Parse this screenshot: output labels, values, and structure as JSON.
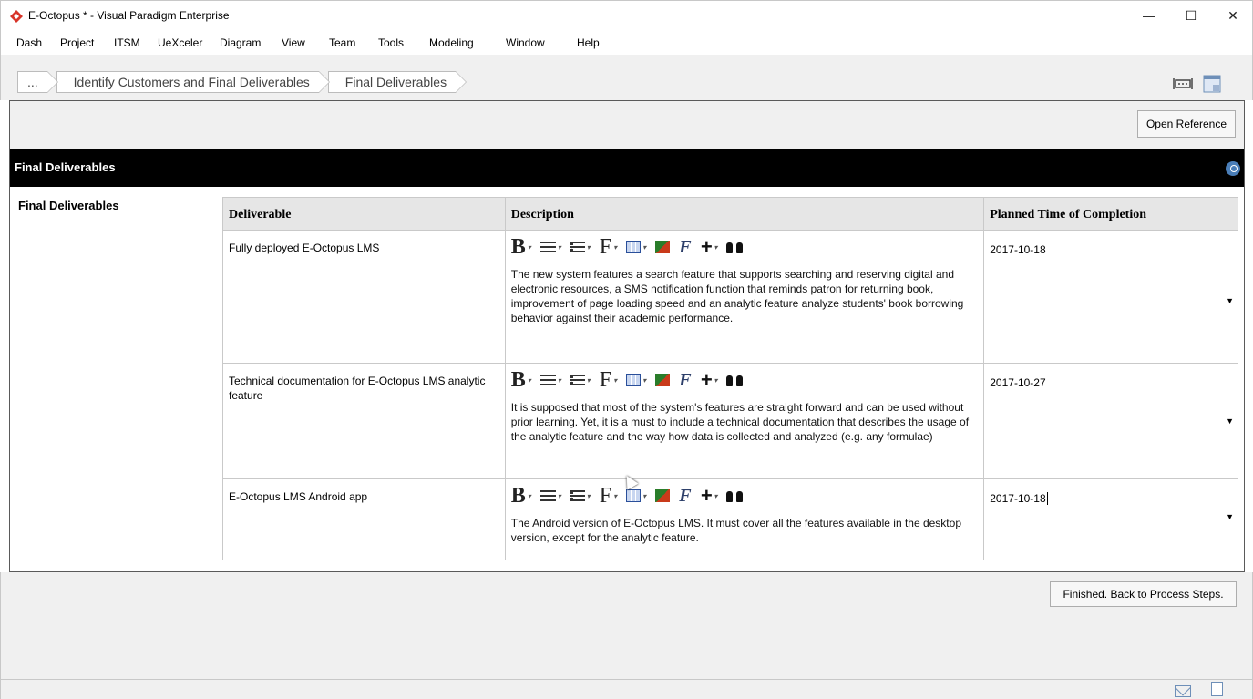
{
  "window": {
    "title": "E-Octopus * - Visual Paradigm Enterprise",
    "controls": {
      "minimize": "—",
      "maximize": "☐",
      "close": "✕"
    }
  },
  "menu": [
    "Dash",
    "Project",
    "ITSM",
    "UeXceler",
    "Diagram",
    "View",
    "Team",
    "Tools",
    "Modeling",
    "Window",
    "Help"
  ],
  "breadcrumb": [
    "...",
    "Identify Customers and Final Deliverables",
    "Final Deliverables"
  ],
  "panel": {
    "open_reference_label": "Open Reference",
    "section_title": "Final Deliverables",
    "field_label": "Final Deliverables",
    "columns": [
      "Deliverable",
      "Description",
      "Planned Time of Completion"
    ],
    "editor_toolbar": {
      "bold": "B",
      "font": "F",
      "caret": "▾",
      "plus": "+"
    },
    "dropdown_arrow": "▼",
    "rows": [
      {
        "deliverable": "Fully deployed E-Octopus LMS",
        "description": "The new system features a search feature that supports searching and reserving digital and electronic resources, a SMS notification function that reminds patron for returning book, improvement of page loading speed and an analytic feature analyze students' book borrowing behavior against their academic performance.",
        "planned": "2017-10-18"
      },
      {
        "deliverable": "Technical documentation for E-Octopus LMS analytic feature",
        "description": "It is supposed that most of the system's features are straight forward and can be used without prior learning. Yet, it is a must to include a technical documentation that describes the usage of the analytic feature and the way how data is collected and analyzed (e.g. any formulae)",
        "planned": "2017-10-27"
      },
      {
        "deliverable": "E-Octopus LMS Android app",
        "description": "The Android version of E-Octopus LMS. It must cover all the features available in the desktop version, except for the analytic feature.",
        "planned": "2017-10-18"
      }
    ]
  },
  "footer": {
    "finished_label": "Finished. Back to Process Steps."
  },
  "colors": {
    "section_header_bg": "#000000",
    "pin_icon": "#4a7eb8",
    "app_icon": "#d8352a"
  }
}
